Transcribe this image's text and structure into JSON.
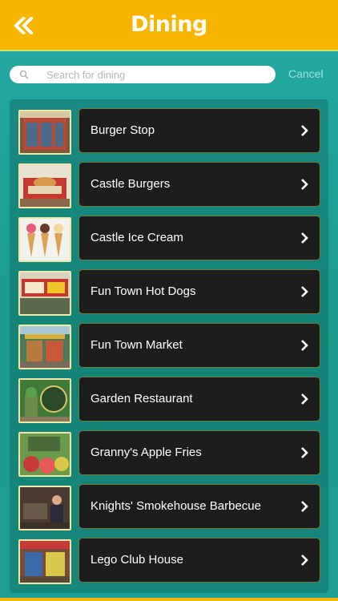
{
  "header": {
    "title": "Dining",
    "back_icon": "double-chevron-left-icon"
  },
  "search": {
    "placeholder": "Search for dining",
    "value": "",
    "cancel_label": "Cancel"
  },
  "colors": {
    "header": "#f7b500",
    "background": "#1e9e94",
    "item_bg": "#1d1d1d"
  },
  "items": [
    {
      "label": "Burger Stop"
    },
    {
      "label": "Castle Burgers"
    },
    {
      "label": "Castle Ice Cream"
    },
    {
      "label": "Fun Town Hot Dogs"
    },
    {
      "label": "Fun Town Market"
    },
    {
      "label": "Garden Restaurant"
    },
    {
      "label": "Granny's Apple Fries"
    },
    {
      "label": "Knights' Smokehouse Barbecue"
    },
    {
      "label": "Lego Club House"
    }
  ]
}
